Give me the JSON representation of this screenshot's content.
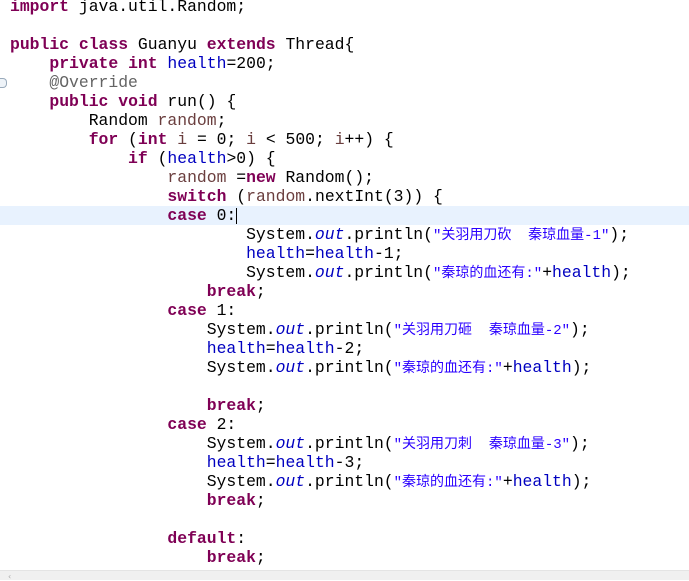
{
  "editor": {
    "language": "java",
    "current_line": 11,
    "colors": {
      "keyword": "#7f0055",
      "field": "#0000c0",
      "annotation": "#646464",
      "string": "#2a00ff",
      "local": "#6a3e3e",
      "current_line_bg": "#e8f2fe"
    },
    "lines": [
      [
        [
          "import",
          "kw"
        ],
        [
          " java.util.Random;",
          ""
        ]
      ],
      [],
      [
        [
          "public",
          "kw"
        ],
        [
          " ",
          ""
        ],
        [
          "class",
          "kw"
        ],
        [
          " Guanyu ",
          ""
        ],
        [
          "extends",
          "kw"
        ],
        [
          " Thread{",
          ""
        ]
      ],
      [
        [
          "    ",
          ""
        ],
        [
          "private",
          "kw"
        ],
        [
          " ",
          ""
        ],
        [
          "int",
          "kw"
        ],
        [
          " ",
          ""
        ],
        [
          "health",
          "field"
        ],
        [
          "=200;",
          ""
        ]
      ],
      [
        [
          "    ",
          ""
        ],
        [
          "@Override",
          "ann"
        ]
      ],
      [
        [
          "    ",
          ""
        ],
        [
          "public",
          "kw"
        ],
        [
          " ",
          ""
        ],
        [
          "void",
          "kw"
        ],
        [
          " run() {",
          ""
        ]
      ],
      [
        [
          "        Random ",
          ""
        ],
        [
          "random",
          "local"
        ],
        [
          ";",
          ""
        ]
      ],
      [
        [
          "        ",
          ""
        ],
        [
          "for",
          "kw"
        ],
        [
          " (",
          ""
        ],
        [
          "int",
          "kw"
        ],
        [
          " ",
          ""
        ],
        [
          "i",
          "local"
        ],
        [
          " = 0; ",
          ""
        ],
        [
          "i",
          "local"
        ],
        [
          " < 500; ",
          ""
        ],
        [
          "i",
          "local"
        ],
        [
          "++) {",
          ""
        ]
      ],
      [
        [
          "            ",
          ""
        ],
        [
          "if",
          "kw"
        ],
        [
          " (",
          ""
        ],
        [
          "health",
          "field"
        ],
        [
          ">0) {",
          ""
        ]
      ],
      [
        [
          "                ",
          ""
        ],
        [
          "random",
          "local"
        ],
        [
          " =",
          ""
        ],
        [
          "new",
          "kw"
        ],
        [
          " Random();",
          ""
        ]
      ],
      [
        [
          "                ",
          ""
        ],
        [
          "switch",
          "kw"
        ],
        [
          " (",
          ""
        ],
        [
          "random",
          "local"
        ],
        [
          ".nextInt(3)) {",
          ""
        ]
      ],
      [
        [
          "                ",
          ""
        ],
        [
          "case",
          "kw"
        ],
        [
          " 0:",
          ""
        ]
      ],
      [
        [
          "                        System.",
          ""
        ],
        [
          "out",
          "static"
        ],
        [
          ".println(",
          ""
        ],
        [
          "\"关羽用刀砍  秦琼血量-1\"",
          "str"
        ],
        [
          ");",
          ""
        ]
      ],
      [
        [
          "                        ",
          ""
        ],
        [
          "health",
          "field"
        ],
        [
          "=",
          ""
        ],
        [
          "health",
          "field"
        ],
        [
          "-1;",
          ""
        ]
      ],
      [
        [
          "                        System.",
          ""
        ],
        [
          "out",
          "static"
        ],
        [
          ".println(",
          ""
        ],
        [
          "\"秦琼的血还有:\"",
          "str"
        ],
        [
          "+",
          ""
        ],
        [
          "health",
          "field"
        ],
        [
          ");",
          ""
        ]
      ],
      [
        [
          "                    ",
          ""
        ],
        [
          "break",
          "kw"
        ],
        [
          ";",
          ""
        ]
      ],
      [
        [
          "                ",
          ""
        ],
        [
          "case",
          "kw"
        ],
        [
          " 1:",
          ""
        ]
      ],
      [
        [
          "                    System.",
          ""
        ],
        [
          "out",
          "static"
        ],
        [
          ".println(",
          ""
        ],
        [
          "\"关羽用刀砸  秦琼血量-2\"",
          "str"
        ],
        [
          ");",
          ""
        ]
      ],
      [
        [
          "                    ",
          ""
        ],
        [
          "health",
          "field"
        ],
        [
          "=",
          ""
        ],
        [
          "health",
          "field"
        ],
        [
          "-2;",
          ""
        ]
      ],
      [
        [
          "                    System.",
          ""
        ],
        [
          "out",
          "static"
        ],
        [
          ".println(",
          ""
        ],
        [
          "\"秦琼的血还有:\"",
          "str"
        ],
        [
          "+",
          ""
        ],
        [
          "health",
          "field"
        ],
        [
          ");",
          ""
        ]
      ],
      [],
      [
        [
          "                    ",
          ""
        ],
        [
          "break",
          "kw"
        ],
        [
          ";",
          ""
        ]
      ],
      [
        [
          "                ",
          ""
        ],
        [
          "case",
          "kw"
        ],
        [
          " 2:",
          ""
        ]
      ],
      [
        [
          "                    System.",
          ""
        ],
        [
          "out",
          "static"
        ],
        [
          ".println(",
          ""
        ],
        [
          "\"关羽用刀刺  秦琼血量-3\"",
          "str"
        ],
        [
          ");",
          ""
        ]
      ],
      [
        [
          "                    ",
          ""
        ],
        [
          "health",
          "field"
        ],
        [
          "=",
          ""
        ],
        [
          "health",
          "field"
        ],
        [
          "-3;",
          ""
        ]
      ],
      [
        [
          "                    System.",
          ""
        ],
        [
          "out",
          "static"
        ],
        [
          ".println(",
          ""
        ],
        [
          "\"秦琼的血还有:\"",
          "str"
        ],
        [
          "+",
          ""
        ],
        [
          "health",
          "field"
        ],
        [
          ");",
          ""
        ]
      ],
      [
        [
          "                    ",
          ""
        ],
        [
          "break",
          "kw"
        ],
        [
          ";",
          ""
        ]
      ],
      [],
      [
        [
          "                ",
          ""
        ],
        [
          "default",
          "kw"
        ],
        [
          ":",
          ""
        ]
      ],
      [
        [
          "                    ",
          ""
        ],
        [
          "break",
          "kw"
        ],
        [
          ";",
          ""
        ]
      ]
    ]
  },
  "scrollbar": {
    "left_arrow_icon": "chevron-left-icon",
    "arrow_glyph": "‹"
  }
}
